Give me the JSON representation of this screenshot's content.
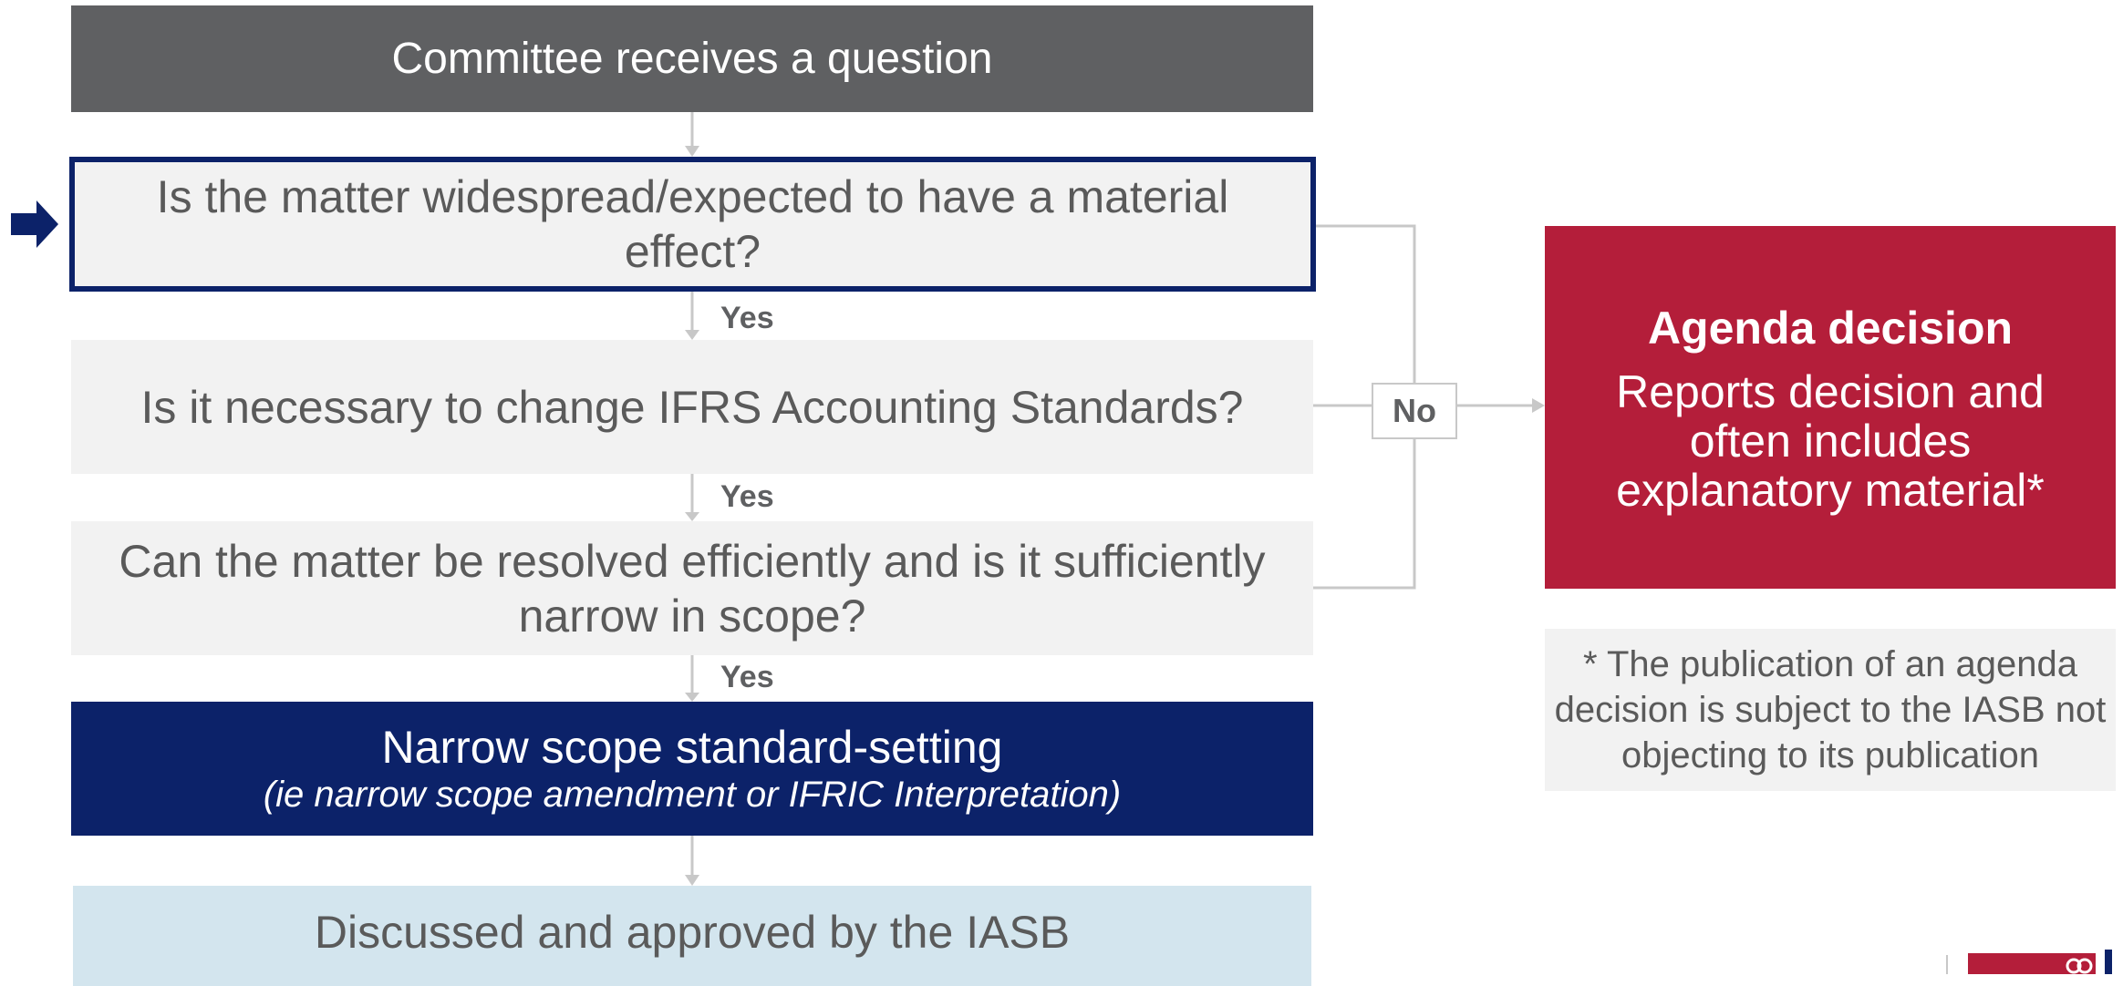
{
  "flow": {
    "start": "Committee receives a question",
    "q1": "Is the matter widespread/expected to have a material effect?",
    "q2": "Is it necessary to change IFRS Accounting Standards?",
    "q3": "Can the matter be resolved efficiently and is it sufficiently narrow in scope?",
    "yes_label": "Yes",
    "no_label": "No",
    "narrow_title": "Narrow scope standard-setting",
    "narrow_subtitle": "(ie narrow scope amendment or IFRIC Interpretation)",
    "iasb": "Discussed and approved by the IASB"
  },
  "agenda": {
    "title": "Agenda decision",
    "body": "Reports decision and often includes explanatory material*"
  },
  "note": "* The publication of an agenda decision is subject to the IASB not objecting to its publication",
  "colors": {
    "grey_box": "#5f6062",
    "light_box": "#f2f2f2",
    "navy": "#0c2269",
    "agenda_red": "#b41e3a",
    "light_blue": "#d3e5ee",
    "connector": "#c8c8c8"
  }
}
